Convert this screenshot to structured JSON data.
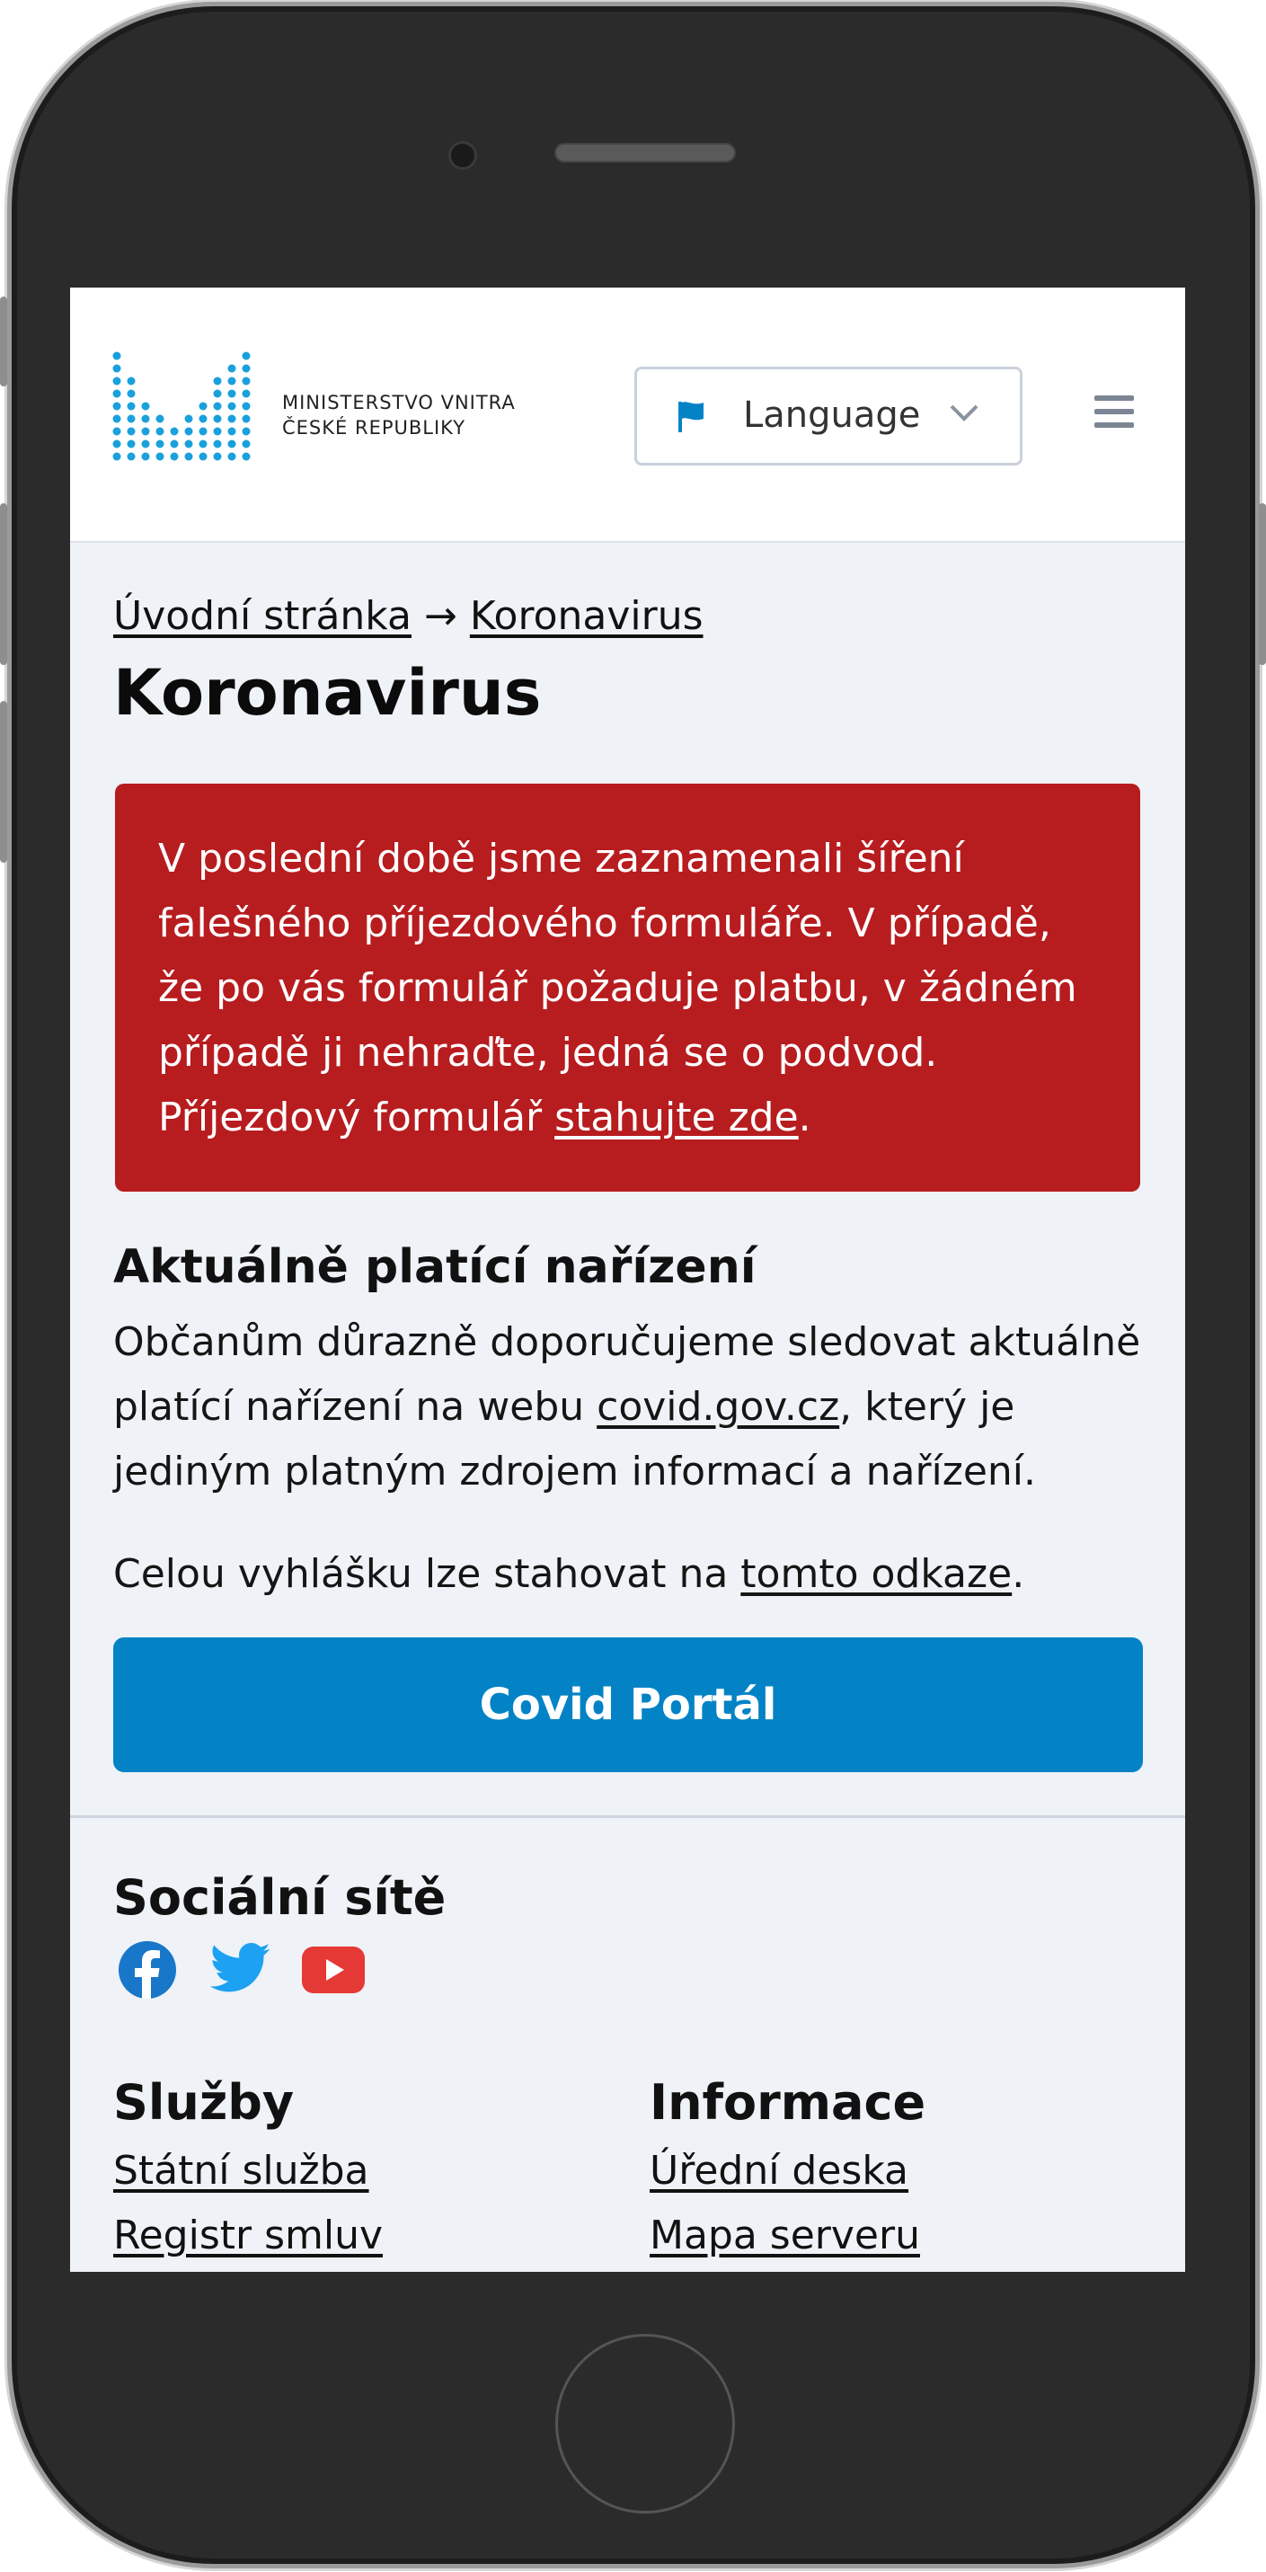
{
  "header": {
    "logo_line1": "MINISTERSTVO VNITRA",
    "logo_line2": "ČESKÉ REPUBLIKY",
    "language_label": "Language",
    "flag_icon": "flag-icon",
    "chevron_icon": "chevron-down-icon",
    "menu_icon": "hamburger-menu-icon"
  },
  "breadcrumb": {
    "home": "Úvodní stránka",
    "separator": "→",
    "current": "Koronavirus"
  },
  "page_title": "Koronavirus",
  "alert": {
    "text_before": "V poslední době jsme zaznamenali šíření falešného příjezdového formuláře. V případě, že po vás formulář požaduje platbu, v žádném případě ji nehraďte, jedná se o podvod. Příjezdový formulář ",
    "link": "stahujte zde",
    "text_after": ".",
    "background": "#b71c1f"
  },
  "regulations": {
    "heading": "Aktuálně platící nařízení",
    "p1_before": "Občanům důrazně doporučujeme sledovat aktuálně platící nařízení na webu ",
    "p1_link": "covid.gov.cz",
    "p1_after": ", který je jediným platným zdrojem informací a nařízení.",
    "p2_before": "Celou vyhlášku lze stahovat na ",
    "p2_link": "tomto odkaze",
    "p2_after": "."
  },
  "covid_button": {
    "label": "Covid Portál",
    "color": "#0383c6"
  },
  "social": {
    "heading": "Sociální sítě",
    "icons": [
      "facebook-icon",
      "twitter-icon",
      "youtube-icon"
    ]
  },
  "footer": {
    "services": {
      "heading": "Služby",
      "links": [
        "Státní služba",
        "Registr smluv"
      ]
    },
    "info": {
      "heading": "Informace",
      "links": [
        "Úřední deska",
        "Mapa serveru"
      ]
    }
  }
}
